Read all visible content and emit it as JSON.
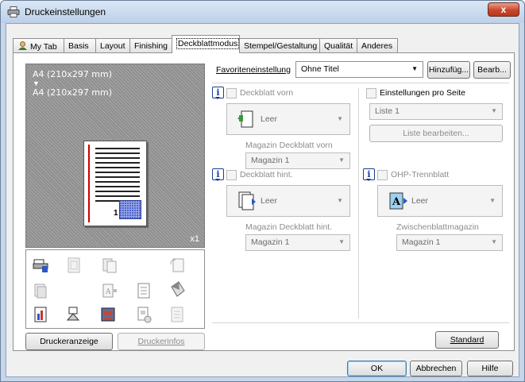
{
  "window": {
    "title": "Druckeinstellungen",
    "close_glyph": "x"
  },
  "tabs": [
    {
      "label": "My Tab"
    },
    {
      "label": "Basis"
    },
    {
      "label": "Layout"
    },
    {
      "label": "Finishing"
    },
    {
      "label": "Deckblattmodus"
    },
    {
      "label": "Stempel/Gestaltung"
    },
    {
      "label": "Qualität"
    },
    {
      "label": "Anderes"
    }
  ],
  "active_tab": "Deckblattmodus",
  "preview": {
    "size_line1": "A4 (210x297 mm)",
    "arrow": "▼",
    "size_line2": "A4 (210x297 mm)",
    "page_number": "1",
    "copies": "x1"
  },
  "left_buttons": {
    "printer_view": "Druckeranzeige",
    "printer_info": "Druckerinfos"
  },
  "favorites": {
    "label": "Favoriteneinstellung",
    "value": "Ohne Titel",
    "add_label": "Hinzufüg...",
    "edit_label": "Bearb..."
  },
  "front_cover": {
    "checkbox_label": "Deckblatt vorn",
    "paper_value": "Leer",
    "tray_label": "Magazin Deckblatt vorn",
    "tray_value": "Magazin 1"
  },
  "back_cover": {
    "checkbox_label": "Deckblatt hint.",
    "paper_value": "Leer",
    "tray_label": "Magazin Deckblatt hint.",
    "tray_value": "Magazin 1"
  },
  "per_page": {
    "checkbox_label": "Einstellungen pro Seite",
    "list_value": "Liste 1",
    "edit_list_label": "Liste bearbeiten..."
  },
  "ohp": {
    "checkbox_label": "OHP-Trennblatt",
    "paper_value": "Leer",
    "tray_label": "Zwischenblattmagazin",
    "tray_value": "Magazin 1"
  },
  "standard_label": "Standard",
  "footer": {
    "ok": "OK",
    "cancel": "Abbrechen",
    "help": "Hilfe"
  },
  "colors": {
    "accent": "#1b3f8f",
    "title_bg": "#c5d6ea",
    "close": "#c9462c"
  }
}
